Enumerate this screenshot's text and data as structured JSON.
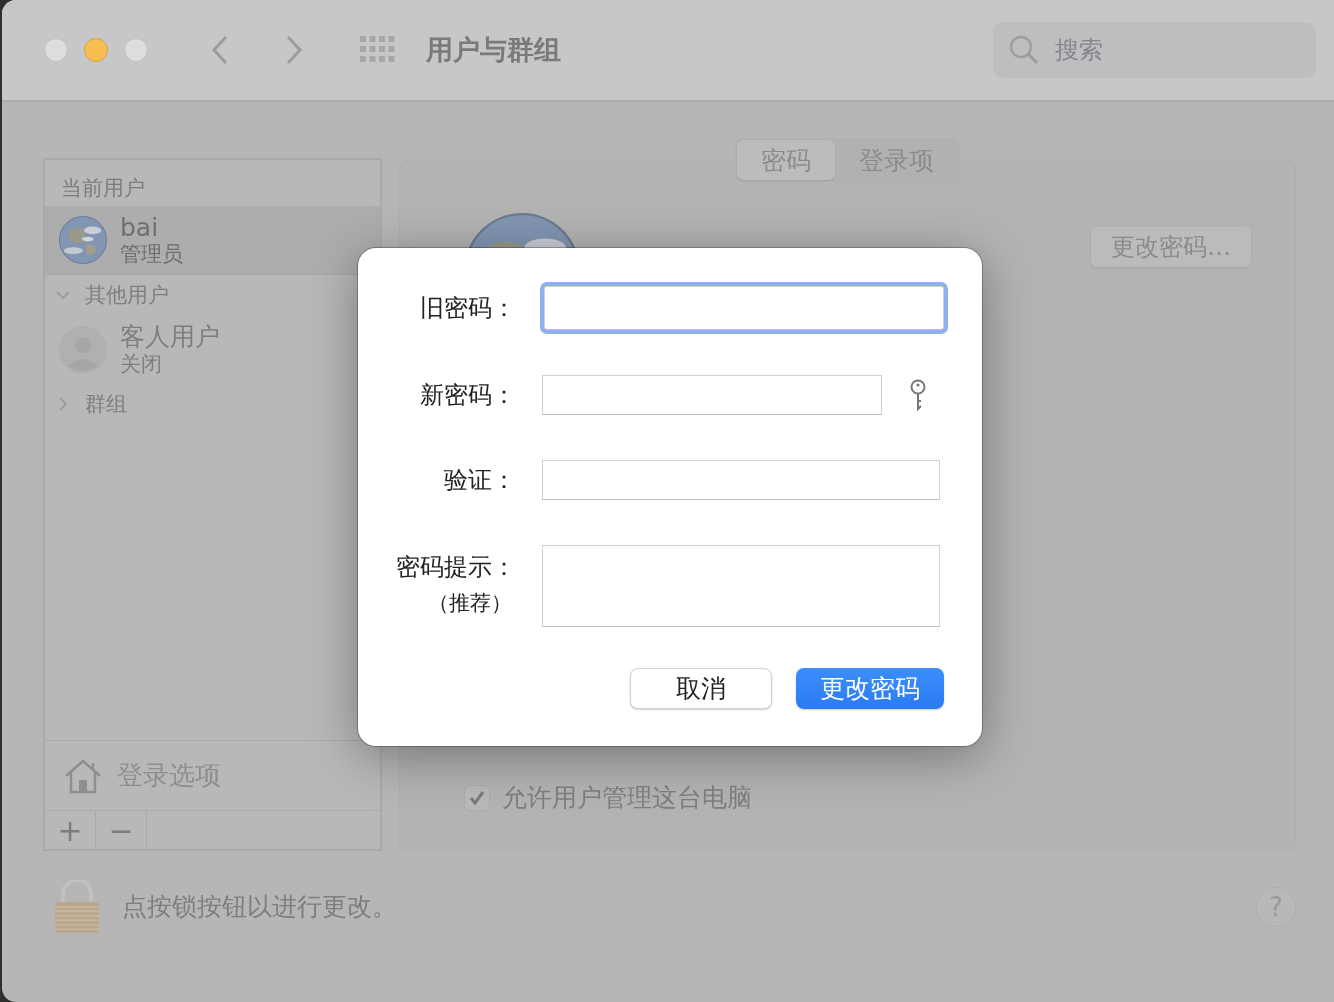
{
  "window": {
    "title": "用户与群组"
  },
  "toolbar": {
    "search": {
      "placeholder": "搜索"
    }
  },
  "sidebar": {
    "current_header": "当前用户",
    "current_user": {
      "name": "bai",
      "role": "管理员",
      "selected": true
    },
    "sections": [
      {
        "label": "其他用户",
        "expanded": true,
        "items": [
          {
            "name": "客人用户",
            "status": "关闭"
          }
        ]
      },
      {
        "label": "群组",
        "expanded": false
      }
    ],
    "login_options": "登录选项",
    "buttons": [
      "+",
      "−"
    ]
  },
  "panel": {
    "tabs": [
      {
        "label": "密码",
        "selected": true
      },
      {
        "label": "登录项",
        "selected": false
      }
    ],
    "change_password_button": "更改密码…",
    "checkbox": {
      "label": "允许用户管理这台电脑",
      "checked": true
    }
  },
  "lock": {
    "text": "点按锁按钮以进行更改。"
  },
  "help": "?",
  "dialog": {
    "fields": [
      {
        "label": "旧密码：",
        "kind": "single",
        "focused": true
      },
      {
        "label": "新密码：",
        "kind": "key",
        "focused": false
      },
      {
        "label": "验证：",
        "kind": "single",
        "focused": false
      },
      {
        "label": "密码提示：",
        "sublabel": "（推荐）",
        "kind": "multi",
        "focused": false
      }
    ],
    "buttons": [
      {
        "label": "取消",
        "default": false
      },
      {
        "label": "更改密码",
        "default": true
      }
    ]
  }
}
